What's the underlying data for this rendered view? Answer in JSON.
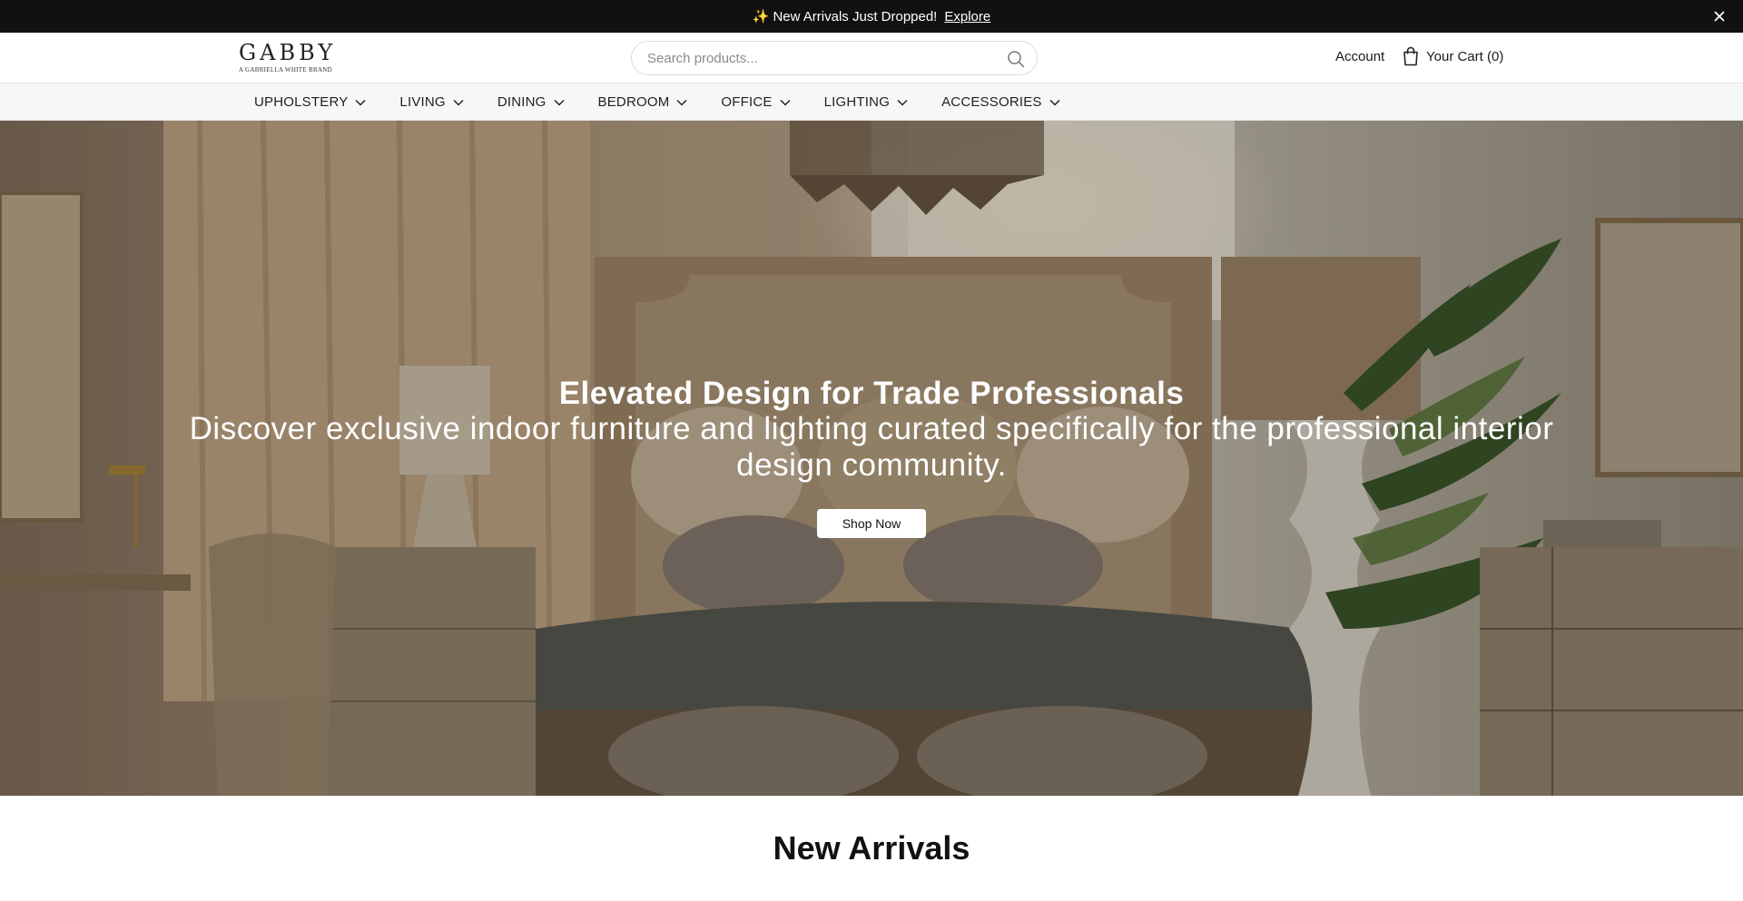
{
  "announcement": {
    "icon": "sparkles-icon",
    "sparkle": "✨",
    "message": "New Arrivals Just Dropped!",
    "link_label": "Explore",
    "close_icon": "close-icon"
  },
  "header": {
    "logo_text": "GABBY",
    "logo_subtext": "A GABRIELLA WHITE BRAND",
    "search": {
      "placeholder": "Search products...",
      "value": "",
      "icon": "search-icon"
    },
    "account_label": "Account",
    "cart_label": "Your Cart (0)",
    "cart_icon": "shopping-bag-icon"
  },
  "nav": {
    "items": [
      {
        "label": "UPHOLSTERY"
      },
      {
        "label": "LIVING"
      },
      {
        "label": "DINING"
      },
      {
        "label": "BEDROOM"
      },
      {
        "label": "OFFICE"
      },
      {
        "label": "LIGHTING"
      },
      {
        "label": "ACCESSORIES"
      }
    ],
    "item_icon": "chevron-down-icon"
  },
  "hero": {
    "title": "Elevated Design for Trade Professionals",
    "subtitle": "Discover exclusive indoor furniture and lighting curated specifically for the professional interior design community.",
    "cta_label": "Shop Now"
  },
  "sections": {
    "new_arrivals_title": "New Arrivals"
  },
  "colors": {
    "announcement_bg": "#111111",
    "nav_bg": "#f6f7f8",
    "text": "#1a1a1a",
    "button_bg": "#ffffff"
  }
}
